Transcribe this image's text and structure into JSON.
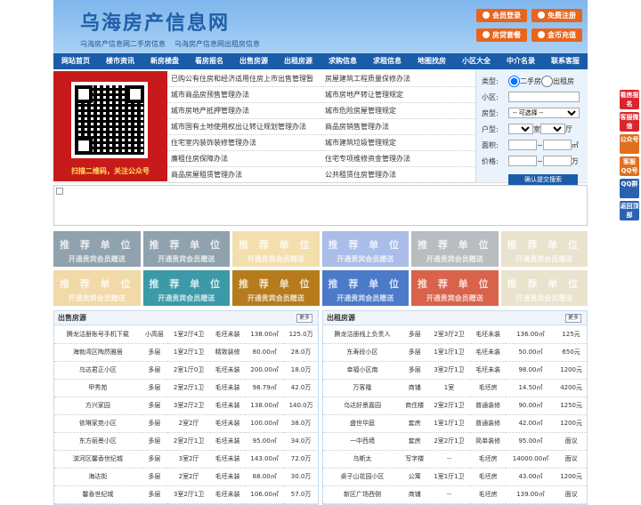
{
  "header": {
    "title": "乌海房产信息网",
    "subtitle1": "乌海房产信息网二手房信息",
    "subtitle2": "乌海房产信息网出租房信息",
    "buttons": [
      "会员登录",
      "免费注册",
      "房贷套餐",
      "金币充值"
    ]
  },
  "nav": [
    "网站首页",
    "楼市资讯",
    "新房楼盘",
    "看房报名",
    "出售房源",
    "出租房源",
    "求购信息",
    "求租信息",
    "地图找房",
    "小区大全",
    "中介名录",
    "联系客服"
  ],
  "qr_caption": "扫描二维码，关注公众号",
  "links_left": [
    "已购公有住房和经济适用住房上市出售管理暂",
    "城市商品房预售管理办法",
    "城市房地产抵押管理办法",
    "城市国有土地使用权出让转让规划管理办法",
    "住宅室内装饰装修管理办法",
    "廉租住房保障办法",
    "商品房屋租赁管理办法"
  ],
  "links_right": [
    "房屋建筑工程质量保修办法",
    "城市房地产转让管理规定",
    "城市危险房屋管理规定",
    "商品房销售管理办法",
    "城市建筑垃圾管理规定",
    "住宅专项维修资金管理办法",
    "公共租赁住房管理办法"
  ],
  "search": {
    "type_label": "类型:",
    "opt1": "二手房",
    "opt2": "出租房",
    "xq_label": "小区:",
    "fx_label": "房型:",
    "fx_select": "-- 可选择 --",
    "hx_label": "户型:",
    "shi": "室",
    "ting": "厅",
    "area_label": "面积:",
    "area_unit": "㎡",
    "price_label": "价格:",
    "price_unit": "万",
    "submit": "确认提交搜索"
  },
  "rec": {
    "t1": "推 荐 单 位",
    "t2": "开通贵宾会员赠送",
    "colors": [
      "#8fa2ad",
      "#8fa2ad",
      "#f3dfae",
      "#a9bde8",
      "#b9bcc0",
      "#e9e2cc",
      "#f1d9a8",
      "#3c9aa8",
      "#b67b1c",
      "#4b7ac8",
      "#d8624a",
      "#e9e2cc"
    ]
  },
  "sale": {
    "title": "出售房源",
    "more": "更多",
    "rows": [
      [
        "腾龙沽册账号手机下载",
        "小高层",
        "1室2厅4卫",
        "毛坯未装",
        "138.00㎡",
        "125.0万"
      ],
      [
        "海勃湾区陶然雅居",
        "多层",
        "1室2厅1卫",
        "精致装修",
        "80.00㎡",
        "28.0万"
      ],
      [
        "乌达君正小区",
        "多层",
        "2室1厅0卫",
        "毛坯未装",
        "200.00㎡",
        "18.0万"
      ],
      [
        "甲秀苑",
        "多层",
        "2室2厅1卫",
        "毛坯未装",
        "98.79㎡",
        "42.0万"
      ],
      [
        "方兴家园",
        "多层",
        "3室2厅2卫",
        "毛坯未装",
        "138.00㎡",
        "140.0万"
      ],
      [
        "依琳家苑小区",
        "多层",
        "2室2厅",
        "毛坯未装",
        "100.00㎡",
        "38.0万"
      ],
      [
        "东方丽景小区",
        "多层",
        "2室2厅1卫",
        "毛坯未装",
        "95.00㎡",
        "34.0万"
      ],
      [
        "滨河区馨香世纪城",
        "多层",
        "3室2厅",
        "毛坯未装",
        "143.00㎡",
        "72.0万"
      ],
      [
        "海达街",
        "多层",
        "2室2厅",
        "毛坯未装",
        "88.00㎡",
        "30.0万"
      ],
      [
        "馨香世纪城",
        "多层",
        "3室2厅1卫",
        "毛坯未装",
        "106.00㎡",
        "57.0万"
      ]
    ]
  },
  "rent": {
    "title": "出租房源",
    "more": "更多",
    "rows": [
      [
        "腾龙沽册线上负责人",
        "多层",
        "2室3厅2卫",
        "毛坯未装",
        "136.00㎡",
        "125元"
      ],
      [
        "东寿段小区",
        "多层",
        "1室1厅1卫",
        "毛坯未装",
        "50.00㎡",
        "650元"
      ],
      [
        "幸福小区南",
        "多层",
        "3室2厅1卫",
        "毛坯未装",
        "98.00㎡",
        "1200元"
      ],
      [
        "万客隆",
        "商铺",
        "1室",
        "毛坯房",
        "14.50㎡",
        "4200元"
      ],
      [
        "乌达好景嘉园",
        "商住楼",
        "2室2厅1卫",
        "普通装修",
        "90.00㎡",
        "1250元"
      ],
      [
        "盛世华庭",
        "套房",
        "1室1厅1卫",
        "普通装修",
        "42.00㎡",
        "1200元"
      ],
      [
        "一中西墙",
        "套房",
        "2室2厅1卫",
        "简单装修",
        "95.00㎡",
        "面议"
      ],
      [
        "乌斯太",
        "写字楼",
        "--",
        "毛坯房",
        "14000.00㎡",
        "面议"
      ],
      [
        "桌子山花园小区",
        "公寓",
        "1室1厅1卫",
        "毛坯房",
        "43.00㎡",
        "1200元"
      ],
      [
        "新区广场西侧",
        "商铺",
        "--",
        "毛坯房",
        "139.00㎡",
        "面议"
      ]
    ]
  },
  "side": [
    "看房报名",
    "客服微信",
    "公众号",
    "客服QQ号",
    "QQ群",
    "返回顶部"
  ]
}
